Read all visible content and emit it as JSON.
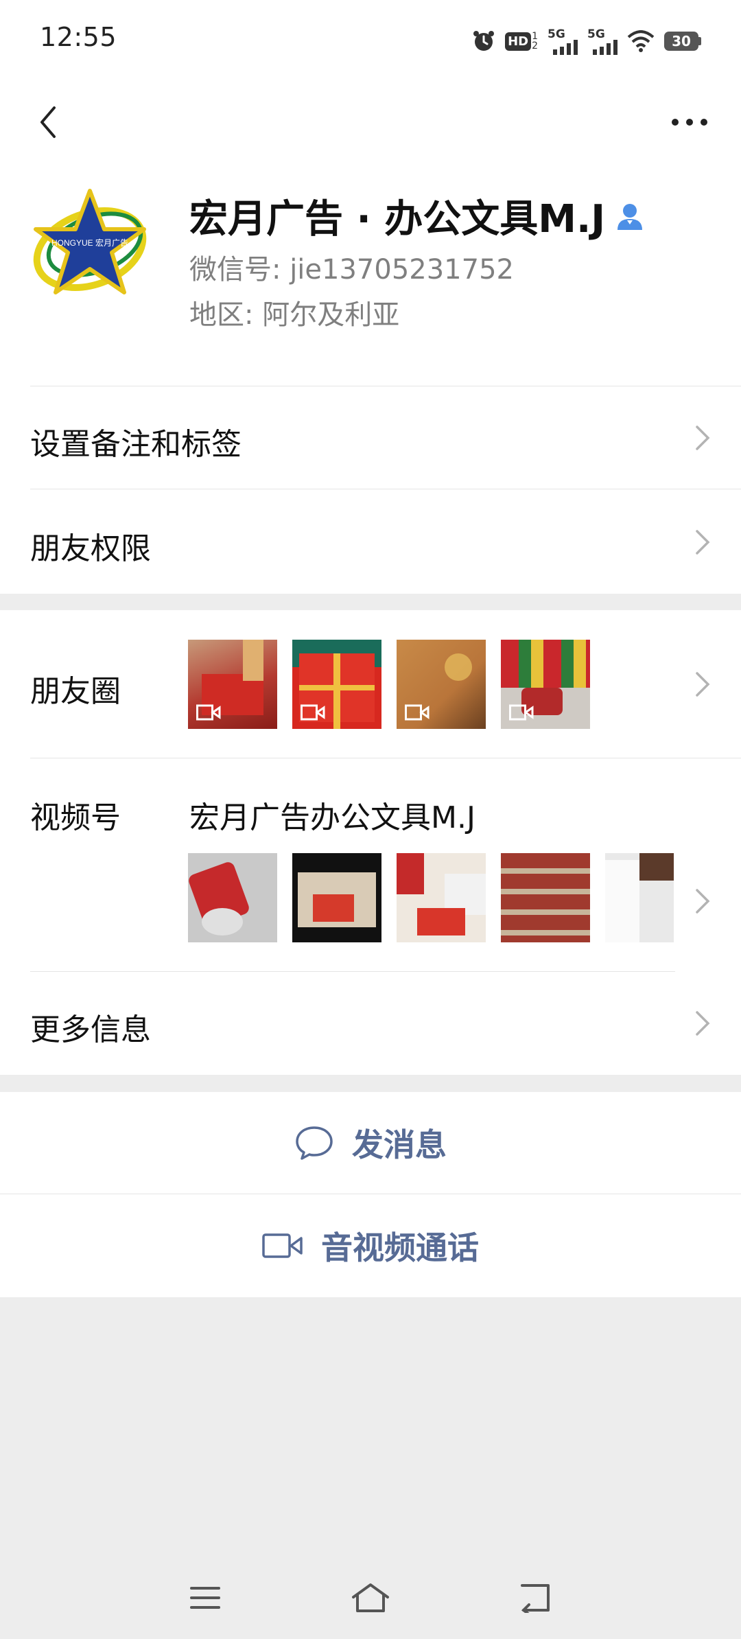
{
  "status_bar": {
    "time": "12:55",
    "battery": "30",
    "network1": "5G",
    "network2": "5G",
    "hd_label": "HD"
  },
  "profile": {
    "name": "宏月广告 · 办公文具M.J",
    "wechat_id": "微信号: jie13705231752",
    "region": "地区: 阿尔及利亚",
    "avatar_text": "HONGYUE 宏月广告"
  },
  "menu": {
    "remark": "设置备注和标签",
    "permissions": "朋友权限",
    "moments": "朋友圈",
    "channels": "视频号",
    "channels_name": "宏月广告办公文具M.J",
    "more_info": "更多信息"
  },
  "actions": {
    "message": "发消息",
    "call": "音视频通话"
  },
  "colors": {
    "accent": "#576b95",
    "background": "#ededed",
    "verify_icon": "#4d8fe6"
  }
}
